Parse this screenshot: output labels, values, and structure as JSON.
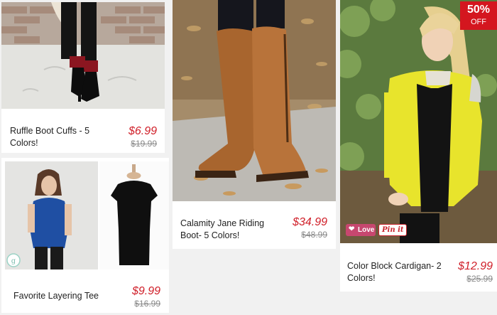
{
  "products": [
    {
      "name": "Ruffle Boot Cuffs - 5 Colors!",
      "sale_price": "$6.99",
      "original_price": "$19.99"
    },
    {
      "name": "Favorite Layering Tee",
      "sale_price": "$9.99",
      "original_price": "$16.99"
    },
    {
      "name": "Calamity Jane Riding Boot- 5 Colors!",
      "sale_price": "$34.99",
      "original_price": "$48.99"
    },
    {
      "name": "Color Block Cardigan- 2 Colors!",
      "sale_price": "$12.99",
      "original_price": "$25.99"
    }
  ],
  "promo_badge": {
    "percent": "50%",
    "label": "OFF"
  },
  "social": {
    "love_label": "Love",
    "pin_label": "Pin it"
  },
  "colors": {
    "sale_red": "#d0202a",
    "badge_red": "#d4161f"
  }
}
